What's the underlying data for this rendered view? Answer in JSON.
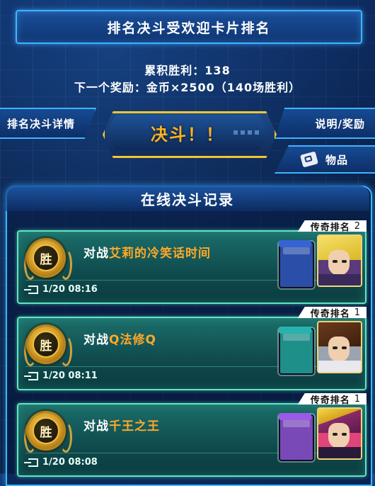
{
  "header": {
    "title": "排名决斗受欢迎卡片排名"
  },
  "stats": {
    "wins_line": "累积胜利：138",
    "next_reward_line": "下一个奖励：金币×2500（140场胜利）"
  },
  "nav": {
    "left_tab": "排名决斗详情",
    "right_tab": "说明/奖励",
    "items_tab": "物品",
    "duel_button": "决斗！！"
  },
  "records": {
    "title": "在线决斗记录",
    "entries": [
      {
        "rank_label": "传奇排名",
        "rank_num": "2",
        "result": "胜",
        "vs": "对战",
        "opponent": "艾莉的冷笑话时间",
        "time": "1/20 08:16",
        "deck_color": "#2b4fa8",
        "avatar": "blonde-hair-avatar"
      },
      {
        "rank_label": "传奇排名",
        "rank_num": "1",
        "result": "胜",
        "vs": "对战",
        "opponent": "Q法修Q",
        "time": "1/20 08:11",
        "deck_color": "#1f8f8a",
        "avatar": "brown-hair-avatar"
      },
      {
        "rank_label": "传奇排名",
        "rank_num": "1",
        "result": "胜",
        "vs": "对战",
        "opponent": "千王之王",
        "time": "1/20 08:08",
        "deck_color": "#7a49b8",
        "avatar": "spiky-hair-avatar"
      }
    ]
  }
}
